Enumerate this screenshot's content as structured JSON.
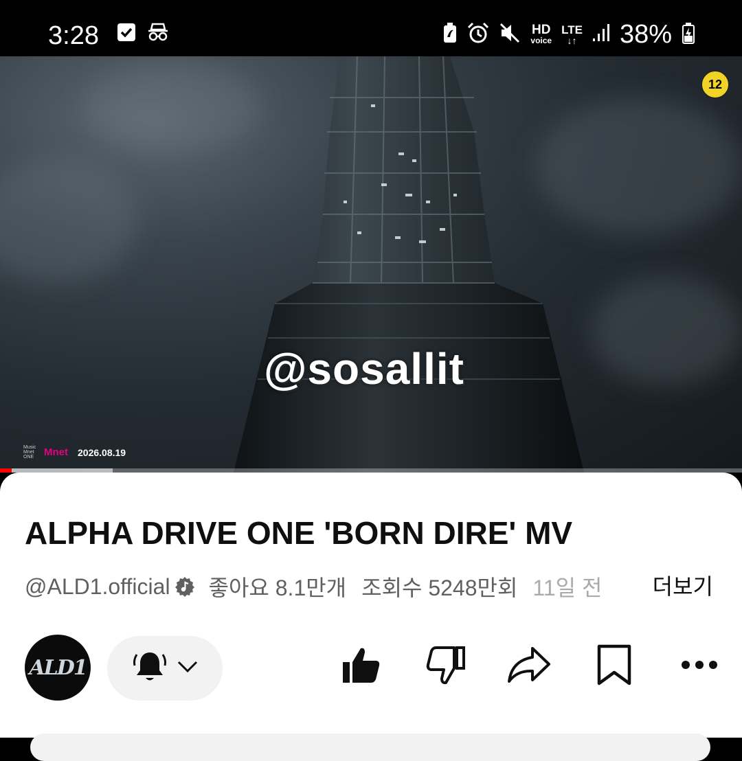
{
  "status_bar": {
    "time": "3:28",
    "left_icons": [
      "checkbox-icon",
      "incognito-icon"
    ],
    "right_icons": [
      "battery-saver-icon",
      "alarm-icon",
      "mute-icon",
      "hd-voice-icon",
      "lte-icon",
      "signal-icon"
    ],
    "hd_label": "HD",
    "voice_label": "voice",
    "lte_label": "LTE",
    "battery": "38%"
  },
  "video": {
    "age_rating": "12",
    "watermark": "@sosallit",
    "broadcaster": "Mnet",
    "broadcaster_small": "Music Mnet ONE",
    "broadcast_date": "2026.08.19",
    "progress_played": 0.016,
    "progress_buffered": 0.152
  },
  "details": {
    "title": "ALPHA DRIVE ONE 'BORN DIRE' MV",
    "channel": "@ALD1.official",
    "likes": "좋아요 8.1만개",
    "views": "조회수 5248만회",
    "age": "11일 전",
    "more_label": "더보기",
    "avatar_text": "ALD1"
  },
  "actions": [
    "like-icon",
    "dislike-icon",
    "share-icon",
    "save-icon",
    "more-icon"
  ]
}
